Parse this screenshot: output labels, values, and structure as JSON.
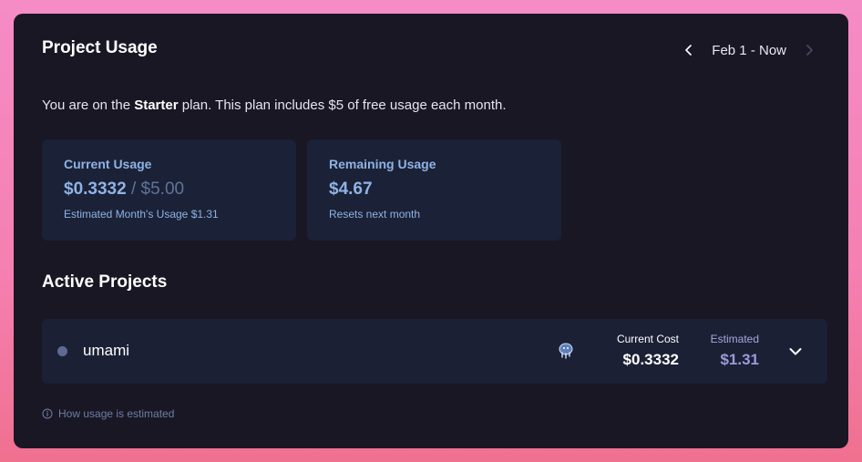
{
  "header": {
    "title": "Project Usage",
    "date_range": "Feb 1 - Now"
  },
  "plan": {
    "prefix": "You are on the ",
    "name": "Starter",
    "suffix": " plan. This plan includes $5 of free usage each month."
  },
  "stats": {
    "current": {
      "label": "Current Usage",
      "value": "$0.3332",
      "separator": " / ",
      "limit": "$5.00",
      "sub": "Estimated Month's Usage $1.31"
    },
    "remaining": {
      "label": "Remaining Usage",
      "value": "$4.67",
      "sub": "Resets next month"
    }
  },
  "active_projects": {
    "title": "Active Projects",
    "items": [
      {
        "name": "umami",
        "service_icon": "postgres-icon",
        "current_cost_label": "Current Cost",
        "current_cost": "$0.3332",
        "estimated_label": "Estimated",
        "estimated": "$1.31"
      }
    ]
  },
  "footer": {
    "help_text": "How usage is estimated"
  },
  "colors": {
    "card_bg": "#191724",
    "stat_bg": "#1b2136",
    "accent_blue": "#8fb3e6",
    "estimated_purple": "#9d9ad8",
    "background_pink": "#f58cc6"
  }
}
